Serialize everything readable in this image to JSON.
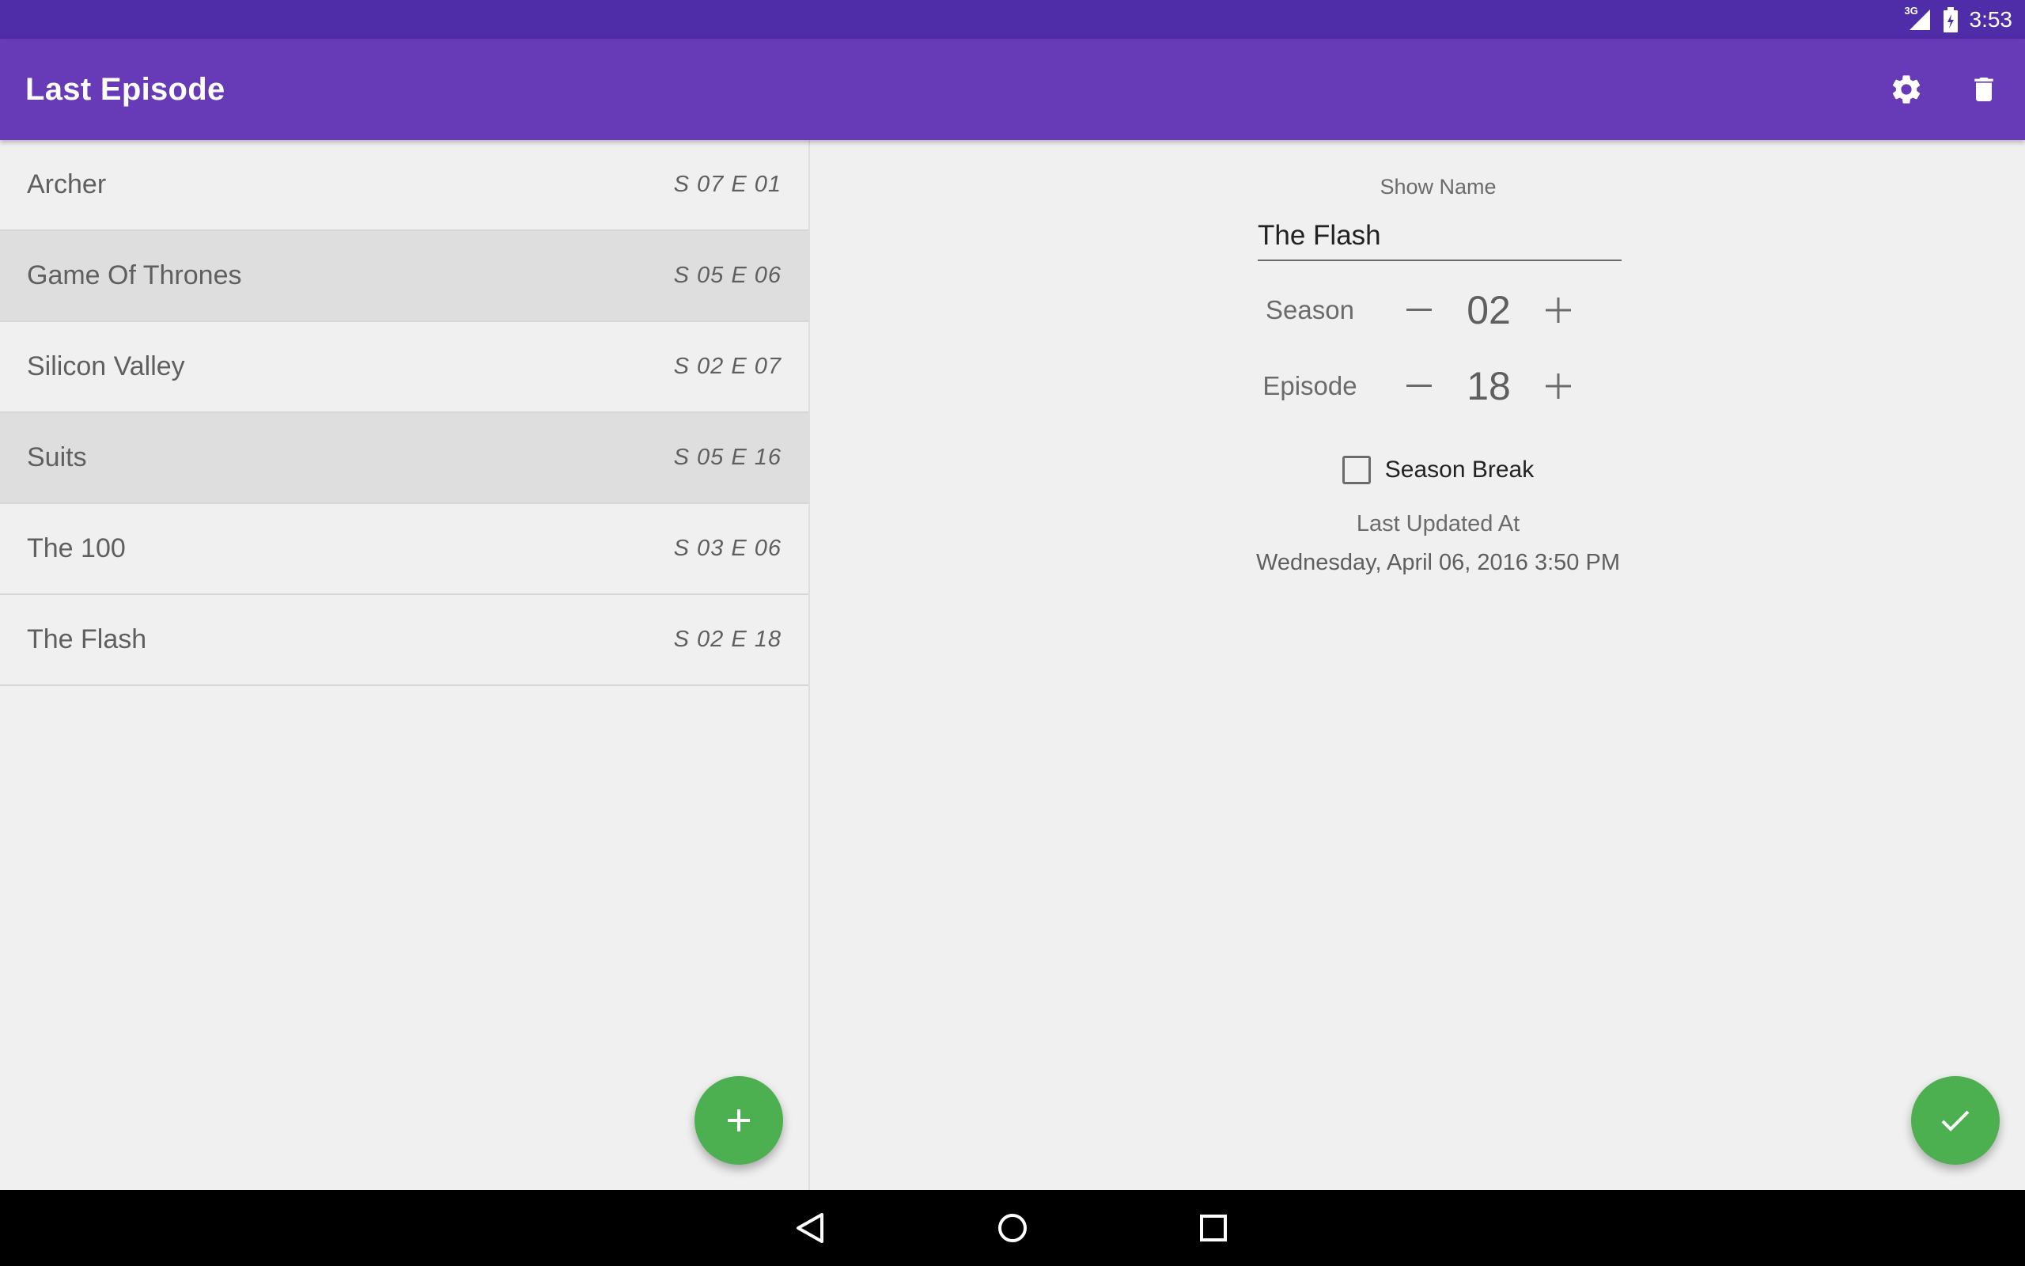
{
  "status_bar": {
    "network": "3G",
    "time": "3:53"
  },
  "app_bar": {
    "title": "Last Episode",
    "settings_icon": "gear-icon",
    "delete_icon": "trash-icon"
  },
  "shows": [
    {
      "name": "Archer",
      "episode": "S 07 E 01"
    },
    {
      "name": "Game Of Thrones",
      "episode": "S 05 E 06"
    },
    {
      "name": "Silicon Valley",
      "episode": "S 02 E 07"
    },
    {
      "name": "Suits",
      "episode": "S 05 E 16"
    },
    {
      "name": "The 100",
      "episode": "S 03 E 06"
    },
    {
      "name": "The Flash",
      "episode": "S 02 E 18"
    }
  ],
  "detail": {
    "show_name_label": "Show Name",
    "show_name_value": "The Flash",
    "season_label": "Season",
    "season_value": "02",
    "episode_label": "Episode",
    "episode_value": "18",
    "minus": "−",
    "plus": "+",
    "season_break_label": "Season Break",
    "last_updated_label": "Last Updated At",
    "last_updated_value": "Wednesday, April 06, 2016 3:50 PM"
  },
  "colors": {
    "status_bar": "#4f2ca8",
    "app_bar": "#673ab7",
    "fab": "#4caf50",
    "list_alt_row": "#dedede"
  },
  "fabs": {
    "add_icon": "plus-icon",
    "save_icon": "check-icon"
  },
  "nav": {
    "back_icon": "back-icon",
    "home_icon": "home-icon",
    "recents_icon": "recents-icon"
  }
}
